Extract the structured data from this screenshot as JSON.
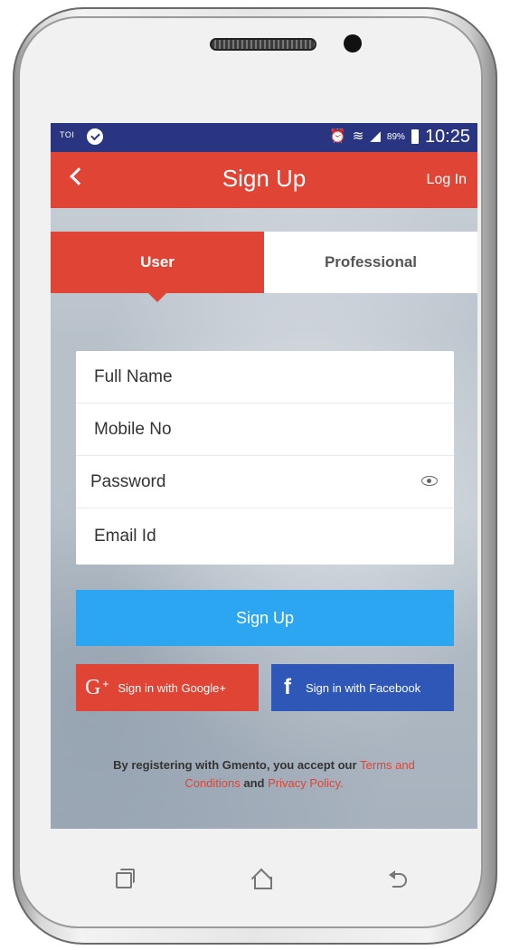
{
  "statusbar": {
    "carrier": "TOI",
    "battery": "89%",
    "time": "10:25",
    "icons": [
      "notification-check-icon",
      "alarm-icon",
      "wifi-icon",
      "signal-icon",
      "battery-icon"
    ]
  },
  "appbar": {
    "title": "Sign Up",
    "login": "Log In",
    "back_icon": "chevron-left-icon"
  },
  "tabs": [
    {
      "label": "User",
      "active": true
    },
    {
      "label": "Professional",
      "active": false
    }
  ],
  "form": {
    "fields": [
      {
        "label": "Full Name"
      },
      {
        "label": "Mobile No"
      },
      {
        "label": "Password",
        "icon": "eye-icon"
      },
      {
        "label": "Email Id"
      }
    ],
    "submit": "Sign Up"
  },
  "social": {
    "google": {
      "icon": "G",
      "plus": "+",
      "label": "Sign in with Google+"
    },
    "facebook": {
      "icon": "f",
      "label": "Sign in with Facebook"
    }
  },
  "terms": {
    "prefix": "By registering with Gmento, you accept our ",
    "terms_link": "Terms and Conditions",
    "middle": " and ",
    "privacy_link": "Privacy Policy."
  },
  "nav_keys": [
    "recent-apps-icon",
    "home-icon",
    "back-icon"
  ],
  "colors": {
    "primary": "#e04434",
    "statusbar": "#2a3582",
    "signup": "#2da6f2",
    "facebook": "#2e57b8"
  }
}
